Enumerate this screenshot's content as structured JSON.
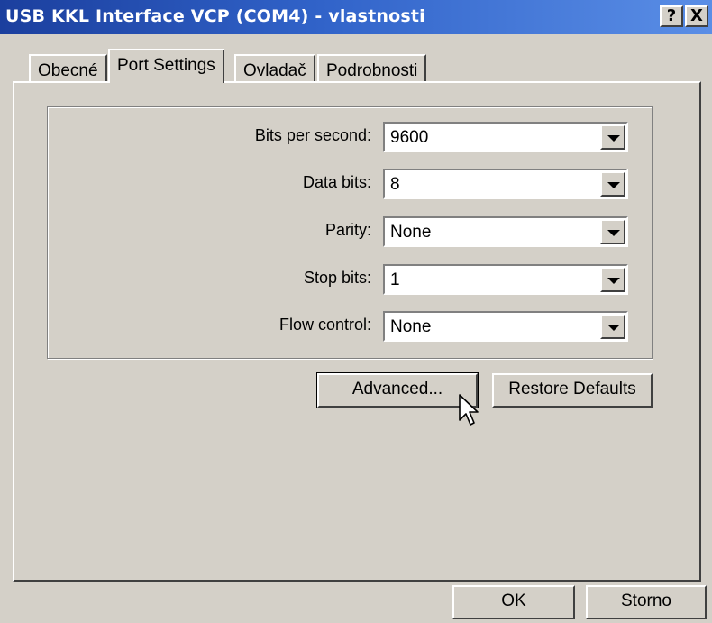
{
  "window": {
    "title": "USB KKL Interface VCP (COM4) - vlastnosti",
    "help_label": "?",
    "close_label": "X"
  },
  "tabs": [
    {
      "label": "Obecné"
    },
    {
      "label": "Port Settings",
      "active": true
    },
    {
      "label": "Ovladač"
    },
    {
      "label": "Podrobnosti"
    }
  ],
  "settings": [
    {
      "label": "Bits per second:",
      "value": "9600"
    },
    {
      "label": "Data bits:",
      "value": "8"
    },
    {
      "label": "Parity:",
      "value": "None"
    },
    {
      "label": "Stop bits:",
      "value": "1"
    },
    {
      "label": "Flow control:",
      "value": "None"
    }
  ],
  "buttons": {
    "advanced": "Advanced...",
    "restore_defaults": "Restore Defaults",
    "ok": "OK",
    "cancel": "Storno"
  },
  "colors": {
    "titlebar": "#2b56b8",
    "face": "#d4d0c8"
  },
  "icons": {
    "cursor": "mouse-pointer-icon",
    "dropdown": "dropdown-arrow-icon"
  }
}
